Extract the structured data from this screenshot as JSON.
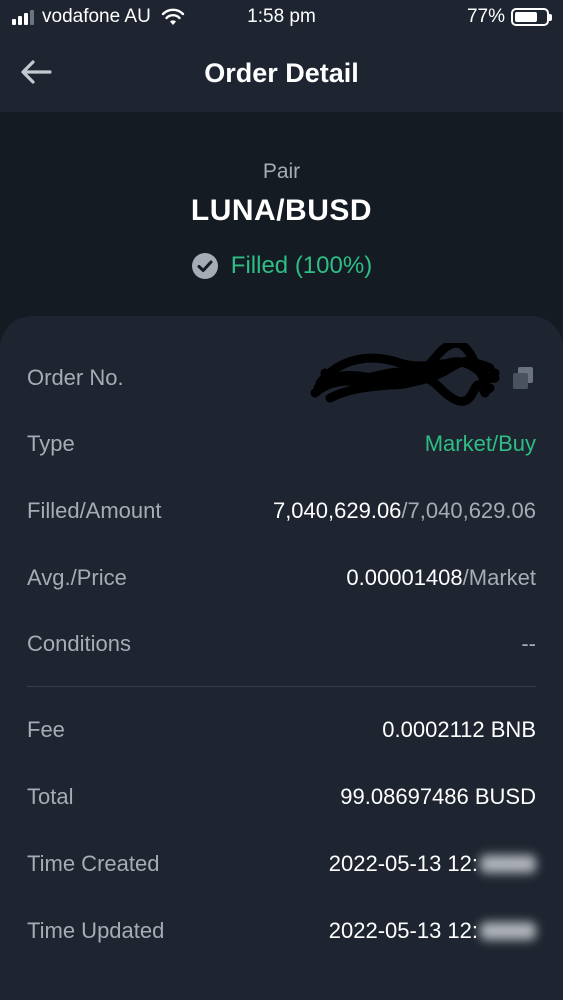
{
  "status_bar": {
    "carrier": "vodafone AU",
    "time": "1:58 pm",
    "battery_percent": "77%",
    "battery_level": 0.77,
    "signal_bars": 4,
    "signal_active": 3
  },
  "nav": {
    "title": "Order Detail",
    "back_icon": "arrow-left-icon"
  },
  "summary": {
    "pair_label": "Pair",
    "pair_value": "LUNA/BUSD",
    "status_text": "Filled (100%)",
    "status_icon": "check-circle-icon",
    "status_color": "#2ebd85"
  },
  "details": {
    "order_no": {
      "label": "Order No.",
      "value": ""
    },
    "type": {
      "label": "Type",
      "value": "Market/Buy"
    },
    "filled_amount": {
      "label": "Filled/Amount",
      "filled": "7,040,629.06",
      "amount": "/7,040,629.06"
    },
    "avg_price": {
      "label": "Avg./Price",
      "avg": "0.00001408",
      "price": "/Market"
    },
    "conditions": {
      "label": "Conditions",
      "value": "--"
    },
    "fee": {
      "label": "Fee",
      "value": "0.0002112 BNB"
    },
    "total": {
      "label": "Total",
      "value": "99.08697486 BUSD"
    },
    "time_created": {
      "label": "Time Created",
      "value": "2022-05-13 12:"
    },
    "time_updated": {
      "label": "Time Updated",
      "value": "2022-05-13 12:"
    }
  },
  "colors": {
    "accent_green": "#2ebd85",
    "background": "#1e2530",
    "hero_background": "#141b22"
  }
}
